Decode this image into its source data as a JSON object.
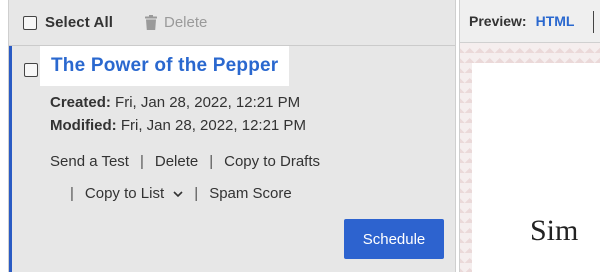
{
  "toolbar": {
    "select_all_label": "Select All",
    "delete_label": "Delete"
  },
  "message": {
    "title": "The Power of the Pepper",
    "created_label": "Created:",
    "created_value": "Fri, Jan 28, 2022, 12:21 PM",
    "modified_label": "Modified:",
    "modified_value": "Fri, Jan 28, 2022, 12:21 PM",
    "actions": {
      "send_test": "Send a Test",
      "delete": "Delete",
      "copy_to_drafts": "Copy to Drafts",
      "copy_to_list": "Copy to List",
      "spam_score": "Spam Score"
    },
    "schedule_label": "Schedule"
  },
  "preview": {
    "label": "Preview:",
    "mode": "HTML",
    "partial_text": "Sim"
  },
  "colors": {
    "accent": "#2a68cf",
    "button": "#2d63cf",
    "panel_bg": "#e7e7e7",
    "selected_border": "#2a5bc4"
  },
  "icons": {
    "delete": "trash-icon",
    "copy_to_list": "chevron-down-icon"
  }
}
